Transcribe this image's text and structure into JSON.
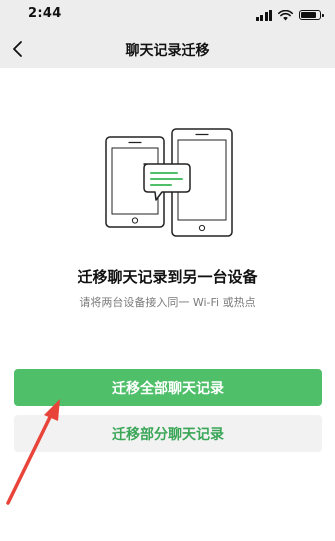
{
  "status_bar": {
    "time": "2:44"
  },
  "nav": {
    "title": "聊天记录迁移",
    "back_icon": "chevron-left-icon"
  },
  "main": {
    "headline": "迁移聊天记录到另一台设备",
    "subtext": "请将两台设备接入同一 Wi-Fi 或热点"
  },
  "buttons": {
    "migrate_all": "迁移全部聊天记录",
    "migrate_partial": "迁移部分聊天记录"
  },
  "colors": {
    "accent_green": "#4fbf6a",
    "secondary_text_green": "#3aa657",
    "nav_background": "#ededed",
    "annotation_arrow": "#e8443a"
  }
}
